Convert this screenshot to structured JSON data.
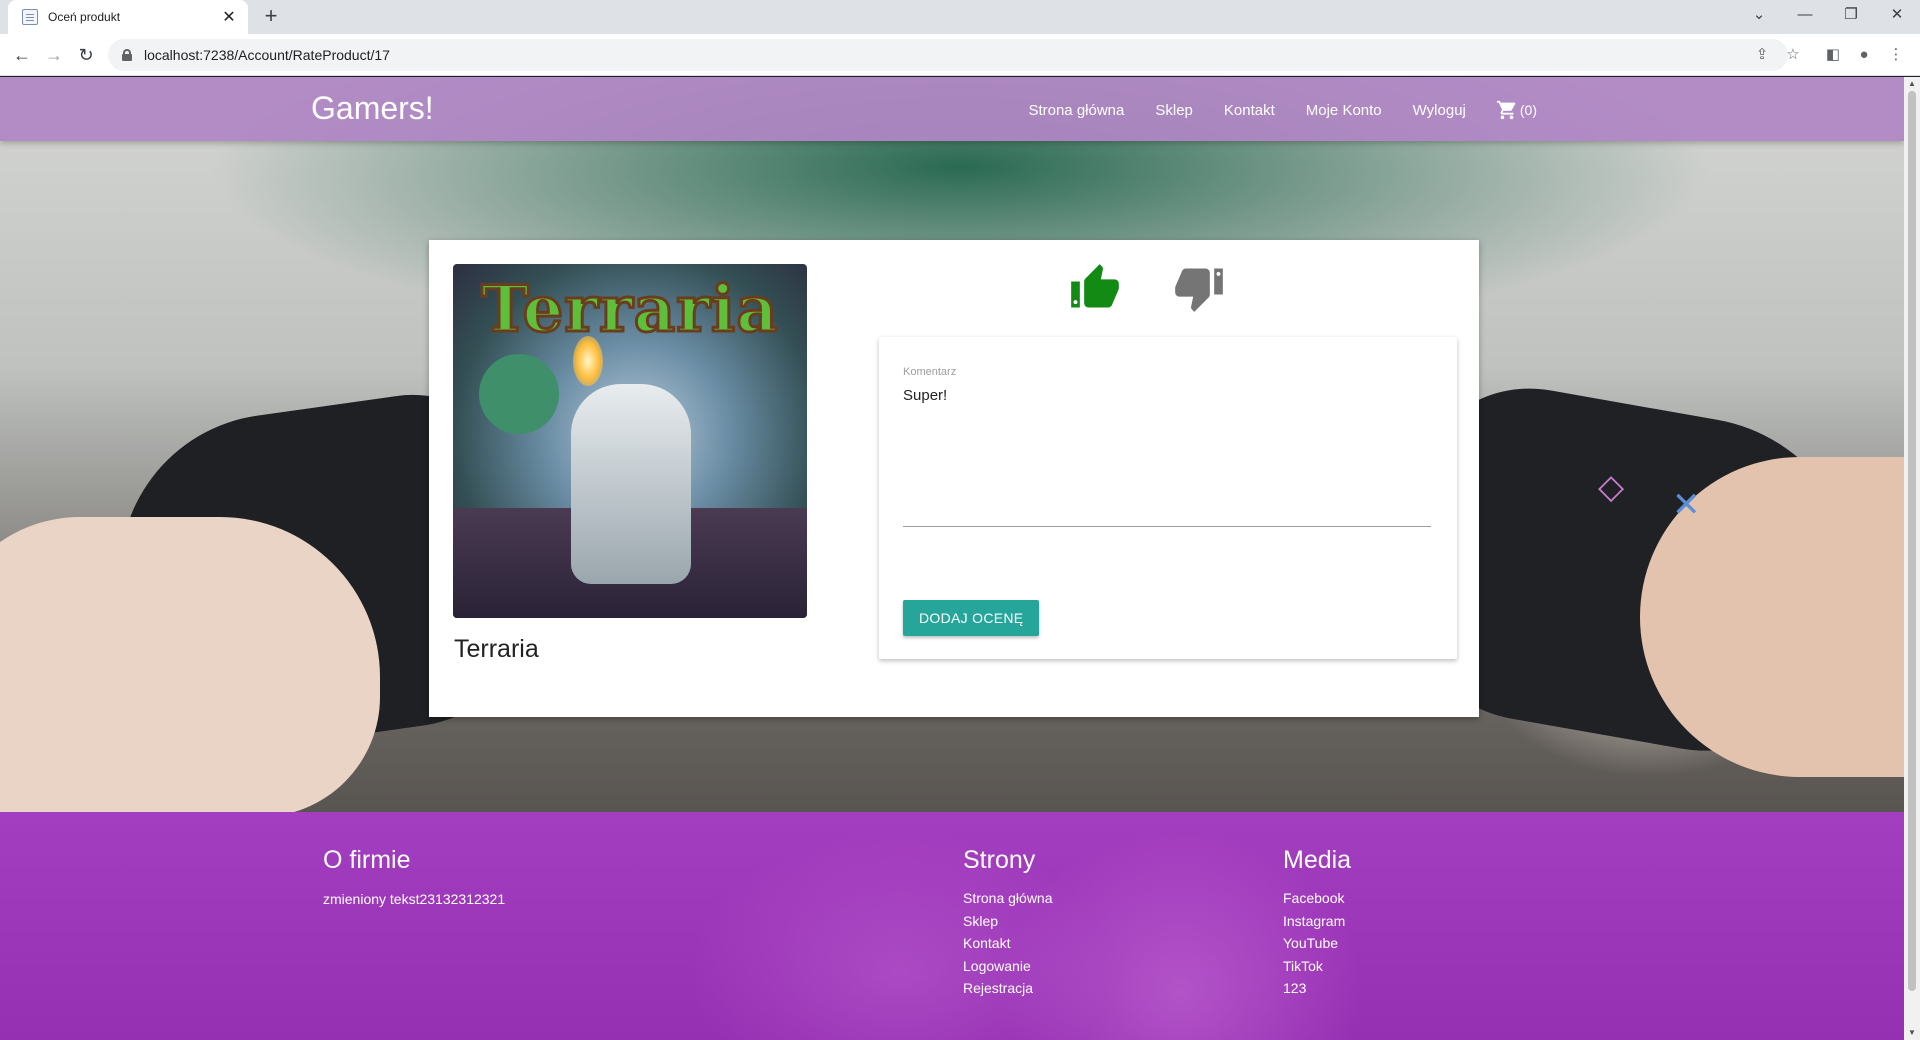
{
  "browser": {
    "tab_title": "Oceń produkt",
    "tab_close": "✕",
    "new_tab": "+",
    "url": "localhost:7238/Account/RateProduct/17",
    "window_controls": {
      "minimize": "—",
      "restore": "❐",
      "close": "✕"
    },
    "nav": {
      "back": "←",
      "forward": "→",
      "reload": "↻"
    }
  },
  "header": {
    "brand": "Gamers!",
    "nav": [
      "Strona główna",
      "Sklep",
      "Kontakt",
      "Moje Konto",
      "Wyloguj"
    ],
    "cart_label": "(0)"
  },
  "product": {
    "name": "Terraria",
    "image_logo_text": "Terraria"
  },
  "rating": {
    "selected": "thumbs-up",
    "colors": {
      "up": "#138a13",
      "down": "#757575"
    },
    "comment_label": "Komentarz",
    "comment_value": "Super!",
    "submit_label": "DODAJ OCENĘ"
  },
  "footer": {
    "about": {
      "heading": "O firmie",
      "text": "zmieniony tekst23132312321"
    },
    "pages": {
      "heading": "Strony",
      "links": [
        "Strona główna",
        "Sklep",
        "Kontakt",
        "Logowanie",
        "Rejestracja"
      ]
    },
    "media": {
      "heading": "Media",
      "links": [
        "Facebook",
        "Instagram",
        "YouTube",
        "TikTok",
        "123"
      ]
    }
  },
  "colors": {
    "header": "#b085c4",
    "footer": "#9e35ba",
    "button": "#26a69a"
  }
}
